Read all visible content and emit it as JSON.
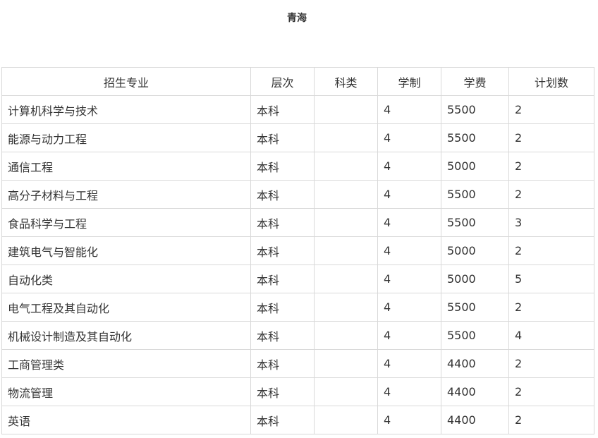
{
  "title": "青海",
  "table": {
    "headers": [
      "招生专业",
      "层次",
      "科类",
      "学制",
      "学费",
      "计划数"
    ],
    "rows": [
      [
        "计算机科学与技术",
        "本科",
        "",
        "4",
        "5500",
        "2"
      ],
      [
        "能源与动力工程",
        "本科",
        "",
        "4",
        "5500",
        "2"
      ],
      [
        "通信工程",
        "本科",
        "",
        "4",
        "5000",
        "2"
      ],
      [
        "高分子材料与工程",
        "本科",
        "",
        "4",
        "5500",
        "2"
      ],
      [
        "食品科学与工程",
        "本科",
        "",
        "4",
        "5500",
        "3"
      ],
      [
        "建筑电气与智能化",
        "本科",
        "",
        "4",
        "5000",
        "2"
      ],
      [
        "自动化类",
        "本科",
        "",
        "4",
        "5000",
        "5"
      ],
      [
        "电气工程及其自动化",
        "本科",
        "",
        "4",
        "5500",
        "2"
      ],
      [
        "机械设计制造及其自动化",
        "本科",
        "",
        "4",
        "5500",
        "4"
      ],
      [
        "工商管理类",
        "本科",
        "",
        "4",
        "4400",
        "2"
      ],
      [
        "物流管理",
        "本科",
        "",
        "4",
        "4400",
        "2"
      ],
      [
        "英语",
        "本科",
        "",
        "4",
        "4400",
        "2"
      ]
    ]
  }
}
